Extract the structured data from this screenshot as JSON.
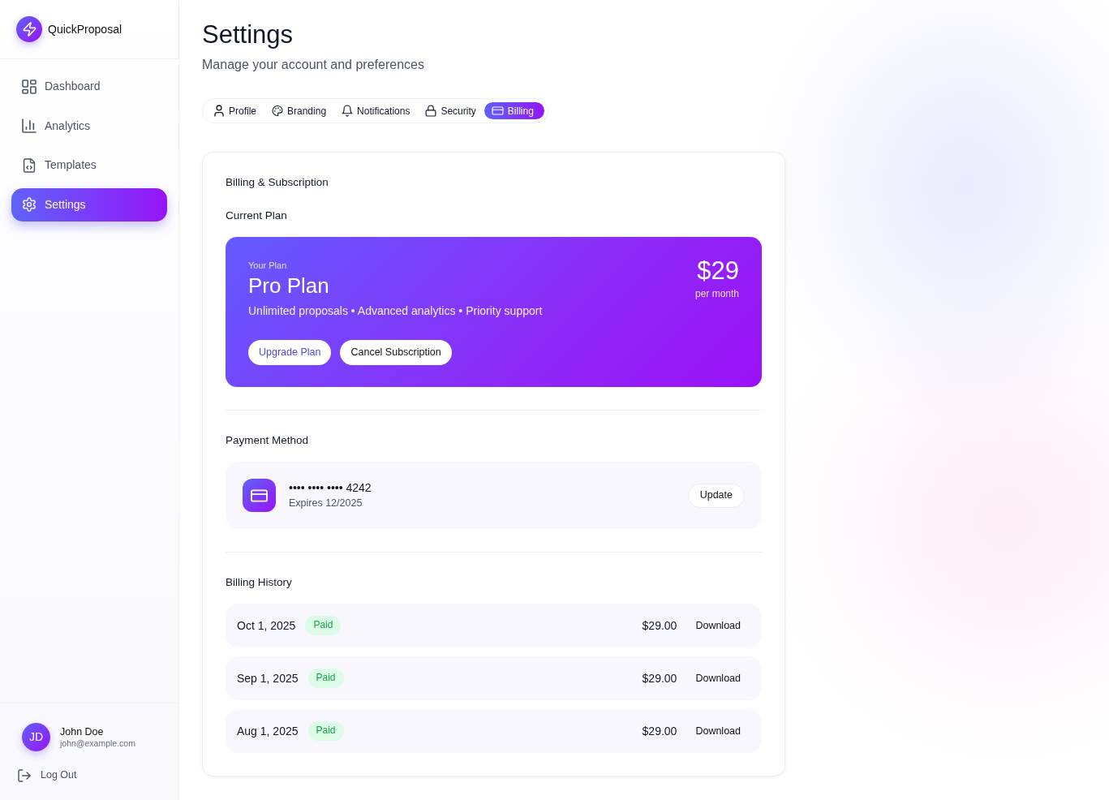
{
  "app": {
    "name": "QuickProposal"
  },
  "sidebar": {
    "items": [
      {
        "label": "Dashboard",
        "selected": false
      },
      {
        "label": "Analytics",
        "selected": false
      },
      {
        "label": "Templates",
        "selected": false
      },
      {
        "label": "Settings",
        "selected": true
      }
    ]
  },
  "user": {
    "initials": "JD",
    "name": "John Doe",
    "email": "john@example.com"
  },
  "logout": "Log Out",
  "page": {
    "title": "Settings",
    "subtitle": "Manage your account and preferences"
  },
  "tabs": [
    {
      "label": "Profile",
      "selected": false
    },
    {
      "label": "Branding",
      "selected": false
    },
    {
      "label": "Notifications",
      "selected": false
    },
    {
      "label": "Security",
      "selected": false
    },
    {
      "label": "Billing",
      "selected": true
    }
  ],
  "billing": {
    "title": "Billing & Subscription",
    "current_plan": {
      "heading": "Current Plan",
      "eyebrow": "Your Plan",
      "name": "Pro Plan",
      "features": "Unlimited proposals • Advanced analytics • Priority support",
      "price": "$29",
      "period": "per month",
      "buttons": [
        {
          "label": "Upgrade Plan",
          "kind": "accent"
        },
        {
          "label": "Cancel Subscription",
          "kind": "plain"
        }
      ]
    },
    "payment_method": {
      "heading": "Payment Method",
      "card_number": "•••• •••• •••• 4242",
      "expiry": "Expires 12/2025",
      "button": "Update"
    },
    "history": {
      "heading": "Billing History",
      "rows": [
        {
          "date": "Oct 1, 2025",
          "status": "Paid",
          "amount": "$29.00",
          "action": "Download"
        },
        {
          "date": "Sep 1, 2025",
          "status": "Paid",
          "amount": "$29.00",
          "action": "Download"
        },
        {
          "date": "Aug 1, 2025",
          "status": "Paid",
          "amount": "$29.00",
          "action": "Download"
        }
      ]
    }
  }
}
